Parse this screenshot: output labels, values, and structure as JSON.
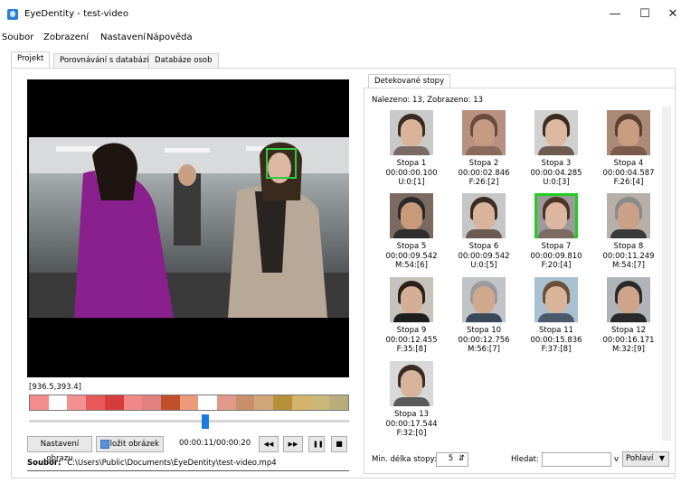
{
  "window": {
    "title": "EyeDentity - test-video",
    "controls": {
      "minimize": "—",
      "maximize": "☐",
      "close": "✕"
    },
    "app_icon": "eye-app-icon"
  },
  "menu": [
    "Soubor",
    "Zobrazení",
    "Nastavení",
    "Nápověda"
  ],
  "tabs": [
    "Projekt",
    "Porovnávání s databází",
    "Databáze osob"
  ],
  "active_tab": "Projekt",
  "player": {
    "coords": "[936.5,393.4]",
    "time": "00:00:11/00:00:20",
    "timeline_colors": [
      "#f48c8c",
      "#ffffff",
      "#f49090",
      "#e85a5a",
      "#d83b3b",
      "#f28787",
      "#e08080",
      "#c0502a",
      "#ec9a7a",
      "#ffffff",
      "#e09a8a",
      "#c98e6a",
      "#d1a77a",
      "#b9903a",
      "#d4b36a",
      "#c9b879",
      "#b8ad7a"
    ],
    "slider_value": 0.55,
    "buttons": {
      "image_settings": "Nastavení obrazu",
      "save_image": "Uložit obrázek",
      "rewind": "◀◀",
      "forward": "▶▶",
      "pause": "❚❚",
      "stop": "■"
    },
    "file_label": "Soubor:",
    "file_path": "C:\\Users\\Public\\Documents\\EyeDentity\\test-video.mp4"
  },
  "detected": {
    "tab": "Detekované stopy",
    "summary": "Nalezeno: 13, Zobrazeno: 13",
    "tracks": [
      {
        "name": "Stopa 1",
        "time": "00:00:00.100",
        "info": "U:0:[1]",
        "skin": "#d9b49a",
        "hair": "#3a2a22",
        "bg": "#c9c9c9",
        "body": "#7a6a64"
      },
      {
        "name": "Stopa 2",
        "time": "00:00:02.846",
        "info": "F:26:[2]",
        "skin": "#c59a82",
        "hair": "#6a4a3a",
        "bg": "#b89080",
        "body": "#8a6a5a"
      },
      {
        "name": "Stopa 3",
        "time": "00:00:04.285",
        "info": "U:0:[3]",
        "skin": "#dcb8a0",
        "hair": "#3b2a20",
        "bg": "#d0d0d0",
        "body": "#6f5a50"
      },
      {
        "name": "Stopa 4",
        "time": "00:00:04.587",
        "info": "F:26:[4]",
        "skin": "#c79c80",
        "hair": "#5a3e2e",
        "bg": "#a88a76",
        "body": "#7a5a4a"
      },
      {
        "name": "Stopa 5",
        "time": "00:00:09.542",
        "info": "M:54:[6]",
        "skin": "#c89a7a",
        "hair": "#2a2a2a",
        "bg": "#7a6a60",
        "body": "#2e2e2e"
      },
      {
        "name": "Stopa 6",
        "time": "00:00:09.542",
        "info": "U:0:[5]",
        "skin": "#d8b29a",
        "hair": "#3a2a22",
        "bg": "#c6c6c6",
        "body": "#6a5a52"
      },
      {
        "name": "Stopa 7",
        "time": "00:00:09.810",
        "info": "F:20:[4]",
        "skin": "#dcb6a0",
        "hair": "#4a3428",
        "bg": "#9a9a9a",
        "body": "#7a6a60",
        "selected": true
      },
      {
        "name": "Stopa 8",
        "time": "00:00:11.249",
        "info": "M:54:[7]",
        "skin": "#caa088",
        "hair": "#8a8a8a",
        "bg": "#b8b0a8",
        "body": "#3a3a3a"
      },
      {
        "name": "Stopa 9",
        "time": "00:00:12.455",
        "info": "F:35:[8]",
        "skin": "#d4ae96",
        "hair": "#2c1e18",
        "bg": "#c8c2bc",
        "body": "#1e1e1e"
      },
      {
        "name": "Stopa 10",
        "time": "00:00:12.756",
        "info": "M:56:[7]",
        "skin": "#d0a88e",
        "hair": "#9a9a9a",
        "bg": "#c0c4c8",
        "body": "#3a4a5a"
      },
      {
        "name": "Stopa 11",
        "time": "00:00:15.836",
        "info": "F:37:[8]",
        "skin": "#d8b49a",
        "hair": "#6a4e3a",
        "bg": "#a8c0d0",
        "body": "#4a5a6a"
      },
      {
        "name": "Stopa 12",
        "time": "00:00:16.171",
        "info": "M:32:[9]",
        "skin": "#cfa48a",
        "hair": "#2a2a2a",
        "bg": "#b0b4b8",
        "body": "#2a2a2a"
      },
      {
        "name": "Stopa 13",
        "time": "00:00:17.544",
        "info": "F:32:[0]",
        "skin": "#d6b49c",
        "hair": "#3a2a22",
        "bg": "#d8d8d8",
        "body": "#5a5a5a"
      }
    ],
    "min_length_label": "Min. délka stopy:",
    "min_length_value": "5",
    "search_label": "Hledat:",
    "search_value": "",
    "filter_conj": "v",
    "filter_option": "Pohlaví"
  },
  "colors": {
    "accent": "#1f7ae0",
    "face_box": "#2ecc40",
    "selected_thumb": "#22cc22"
  }
}
